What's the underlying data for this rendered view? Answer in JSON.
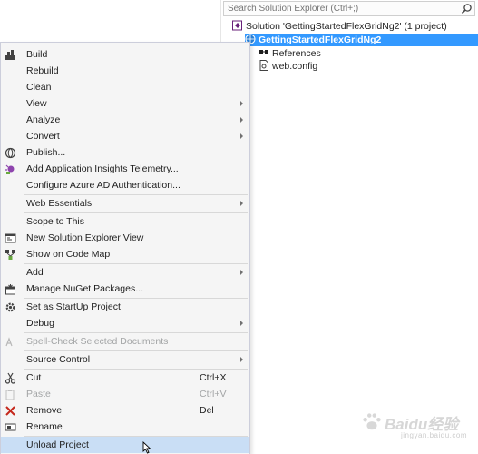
{
  "solution_explorer": {
    "search_placeholder": "Search Solution Explorer (Ctrl+;)",
    "nodes": {
      "solution": "Solution 'GettingStartedFlexGridNg2' (1 project)",
      "project": "GettingStartedFlexGridNg2",
      "references": "References",
      "webconfig": "web.config"
    },
    "selection_color": "#3399ff"
  },
  "context_menu": {
    "highlight_color": "#c9def5",
    "items": {
      "build": {
        "label": "Build"
      },
      "rebuild": {
        "label": "Rebuild"
      },
      "clean": {
        "label": "Clean"
      },
      "view": {
        "label": "View"
      },
      "analyze": {
        "label": "Analyze"
      },
      "convert": {
        "label": "Convert"
      },
      "publish": {
        "label": "Publish..."
      },
      "app_insights": {
        "label": "Add Application Insights Telemetry..."
      },
      "azure_ad": {
        "label": "Configure Azure AD Authentication..."
      },
      "web_essentials": {
        "label": "Web Essentials"
      },
      "scope": {
        "label": "Scope to This"
      },
      "new_view": {
        "label": "New Solution Explorer View"
      },
      "code_map": {
        "label": "Show on Code Map"
      },
      "add": {
        "label": "Add"
      },
      "nuget": {
        "label": "Manage NuGet Packages..."
      },
      "startup": {
        "label": "Set as StartUp Project"
      },
      "debug": {
        "label": "Debug"
      },
      "spellcheck": {
        "label": "Spell-Check Selected Documents"
      },
      "source_control": {
        "label": "Source Control"
      },
      "cut": {
        "label": "Cut",
        "shortcut": "Ctrl+X"
      },
      "paste": {
        "label": "Paste",
        "shortcut": "Ctrl+V"
      },
      "remove": {
        "label": "Remove",
        "shortcut": "Del"
      },
      "rename": {
        "label": "Rename"
      },
      "unload": {
        "label": "Unload Project"
      }
    }
  },
  "watermark": {
    "brand": "Baidu经验",
    "sub": "jingyan.baidu.com"
  }
}
